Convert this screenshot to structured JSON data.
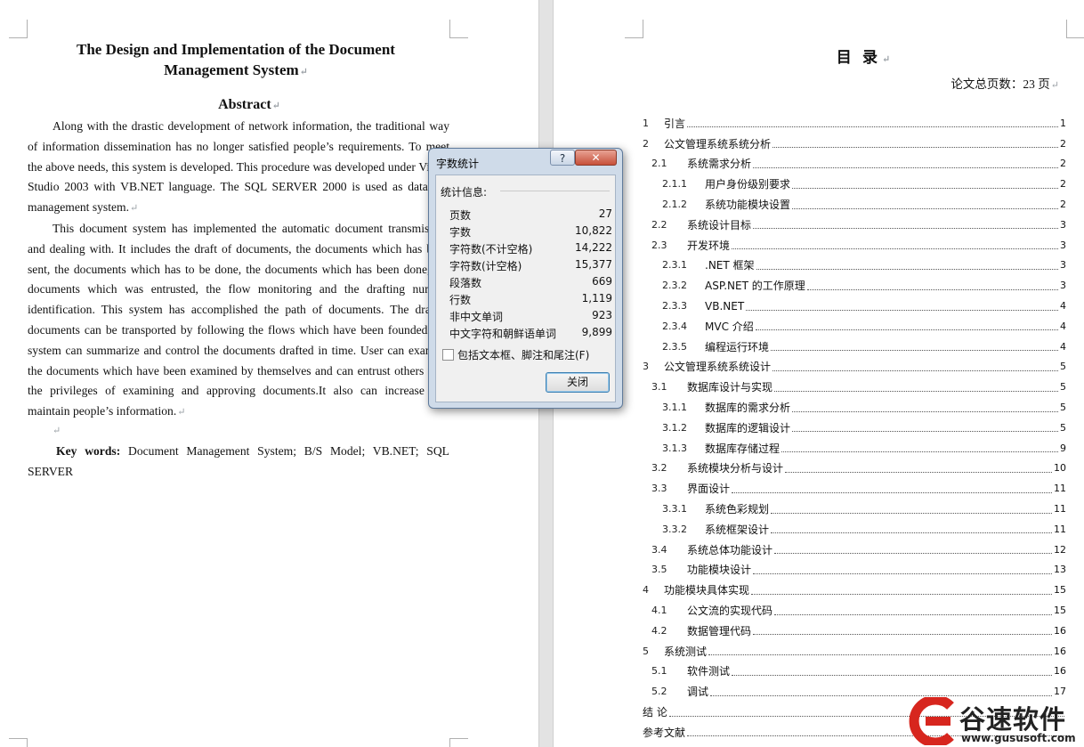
{
  "left_page": {
    "title_line1": "The Design and Implementation of the Document",
    "title_line2": "Management System",
    "abstract_heading": "Abstract",
    "paragraph1": "Along with the drastic development of network information, the traditional way of information dissemination has no longer satisfied people’s requirements. To meet the above needs, this system is developed. This procedure was developed under Visual Studio 2003 with VB.NET language. The SQL SERVER 2000 is used as database management system.",
    "paragraph2": "This document system has implemented the automatic document transmission and dealing with. It includes the draft of documents, the documents which has been sent, the documents which has to be done, the documents which has been done, the documents which was entrusted, the flow monitoring and the drafting number identification. This system has accomplished the path of documents. The drafted documents can be transported by following the flows which have been founded.The system can summarize and control the documents drafted in time. User can examine the documents which have been examined by themselves and can entrust others with the privileges of examining and approving documents.It also can increase and maintain people’s information.",
    "keywords_label": "Key words:",
    "keywords_text": "Document Management System; B/S Model; VB.NET; SQL SERVER"
  },
  "right_page": {
    "toc_title": "目  录",
    "total_pages": "论文总页数：23 页",
    "toc": [
      {
        "level": 1,
        "num": "1",
        "text": "引言",
        "page": "1"
      },
      {
        "level": 1,
        "num": "2",
        "text": "公文管理系统系统分析",
        "page": "2"
      },
      {
        "level": 2,
        "num": "2.1",
        "text": "系统需求分析",
        "page": "2"
      },
      {
        "level": 3,
        "num": "2.1.1",
        "text": "用户身份级别要求",
        "page": "2"
      },
      {
        "level": 3,
        "num": "2.1.2",
        "text": "系统功能模块设置",
        "page": "2"
      },
      {
        "level": 2,
        "num": "2.2",
        "text": "系统设计目标",
        "page": "3"
      },
      {
        "level": 2,
        "num": "2.3",
        "text": "开发环境",
        "page": "3"
      },
      {
        "level": 3,
        "num": "2.3.1",
        "text": ".NET 框架",
        "page": "3"
      },
      {
        "level": 3,
        "num": "2.3.2",
        "text": "ASP.NET 的工作原理",
        "page": "3"
      },
      {
        "level": 3,
        "num": "2.3.3",
        "text": "VB.NET",
        "page": "4"
      },
      {
        "level": 3,
        "num": "2.3.4",
        "text": "MVC 介绍",
        "page": "4"
      },
      {
        "level": 3,
        "num": "2.3.5",
        "text": "编程运行环境",
        "page": "4"
      },
      {
        "level": 1,
        "num": "3",
        "text": "公文管理系统系统设计",
        "page": "5"
      },
      {
        "level": 2,
        "num": "3.1",
        "text": "数据库设计与实现",
        "page": "5"
      },
      {
        "level": 3,
        "num": "3.1.1",
        "text": "数据库的需求分析",
        "page": "5"
      },
      {
        "level": 3,
        "num": "3.1.2",
        "text": "数据库的逻辑设计",
        "page": "5"
      },
      {
        "level": 3,
        "num": "3.1.3",
        "text": "数据库存储过程",
        "page": "9"
      },
      {
        "level": 2,
        "num": "3.2",
        "text": "系统模块分析与设计",
        "page": "10"
      },
      {
        "level": 2,
        "num": "3.3",
        "text": "界面设计",
        "page": "11"
      },
      {
        "level": 3,
        "num": "3.3.1",
        "text": "系统色彩规划",
        "page": "11"
      },
      {
        "level": 3,
        "num": "3.3.2",
        "text": "系统框架设计",
        "page": "11"
      },
      {
        "level": 2,
        "num": "3.4",
        "text": "系统总体功能设计",
        "page": "12"
      },
      {
        "level": 2,
        "num": "3.5",
        "text": "功能模块设计",
        "page": "13"
      },
      {
        "level": 1,
        "num": "4",
        "text": "功能模块具体实现",
        "page": "15"
      },
      {
        "level": 2,
        "num": "4.1",
        "text": "公文流的实现代码",
        "page": "15"
      },
      {
        "level": 2,
        "num": "4.2",
        "text": "数据管理代码",
        "page": "16"
      },
      {
        "level": 1,
        "num": "5",
        "text": "系统测试",
        "page": "16"
      },
      {
        "level": 2,
        "num": "5.1",
        "text": "软件测试",
        "page": "16"
      },
      {
        "level": 2,
        "num": "5.2",
        "text": "调试",
        "page": "17"
      },
      {
        "level": 1,
        "num": "",
        "text": "结    论",
        "page": ""
      },
      {
        "level": 1,
        "num": "",
        "text": "参考文献",
        "page": ""
      }
    ]
  },
  "dialog": {
    "title": "字数统计",
    "help_label": "?",
    "close_x_label": "✕",
    "group_label": "统计信息:",
    "stats": [
      {
        "label": "页数",
        "value": "27"
      },
      {
        "label": "字数",
        "value": "10,822"
      },
      {
        "label": "字符数(不计空格)",
        "value": "14,222"
      },
      {
        "label": "字符数(计空格)",
        "value": "15,377"
      },
      {
        "label": "段落数",
        "value": "669"
      },
      {
        "label": "行数",
        "value": "1,119"
      },
      {
        "label": "非中文单词",
        "value": "923"
      },
      {
        "label": "中文字符和朝鲜语单词",
        "value": "9,899"
      }
    ],
    "checkbox_label": "包括文本框、脚注和尾注(F)",
    "checkbox_checked": false,
    "close_button_label": "关闭"
  },
  "watermark": {
    "brand_cn": "谷速软件",
    "url": "www.gususoft.com",
    "accent_color": "#d7261e"
  }
}
